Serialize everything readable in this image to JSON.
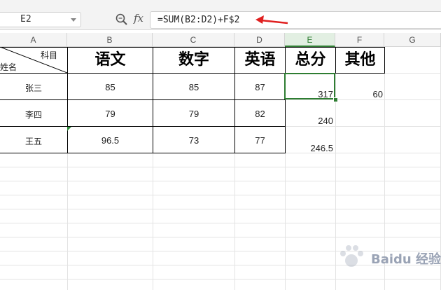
{
  "formula_bar": {
    "cell_ref": "E2",
    "formula": "=SUM(B2:D2)+F$2",
    "fx_label": "fx"
  },
  "columns": [
    "A",
    "B",
    "C",
    "D",
    "E",
    "F",
    "G"
  ],
  "active_column": "E",
  "header_cell": {
    "top_label": "科目",
    "bottom_label": "姓名"
  },
  "headers": [
    "语文",
    "数字",
    "英语",
    "总分",
    "其他"
  ],
  "rows": [
    {
      "name": "张三",
      "chinese": "85",
      "math": "85",
      "english": "87",
      "total": "317",
      "other": "60"
    },
    {
      "name": "李四",
      "chinese": "79",
      "math": "79",
      "english": "82",
      "total": "240",
      "other": ""
    },
    {
      "name": "王五",
      "chinese": "96.5",
      "math": "73",
      "english": "77",
      "total": "246.5",
      "other": ""
    }
  ],
  "selected_cell": "E2",
  "colors": {
    "accent_green": "#2e7d32",
    "arrow_red": "#e02020"
  },
  "watermark": {
    "text": "Baidu 经验"
  }
}
